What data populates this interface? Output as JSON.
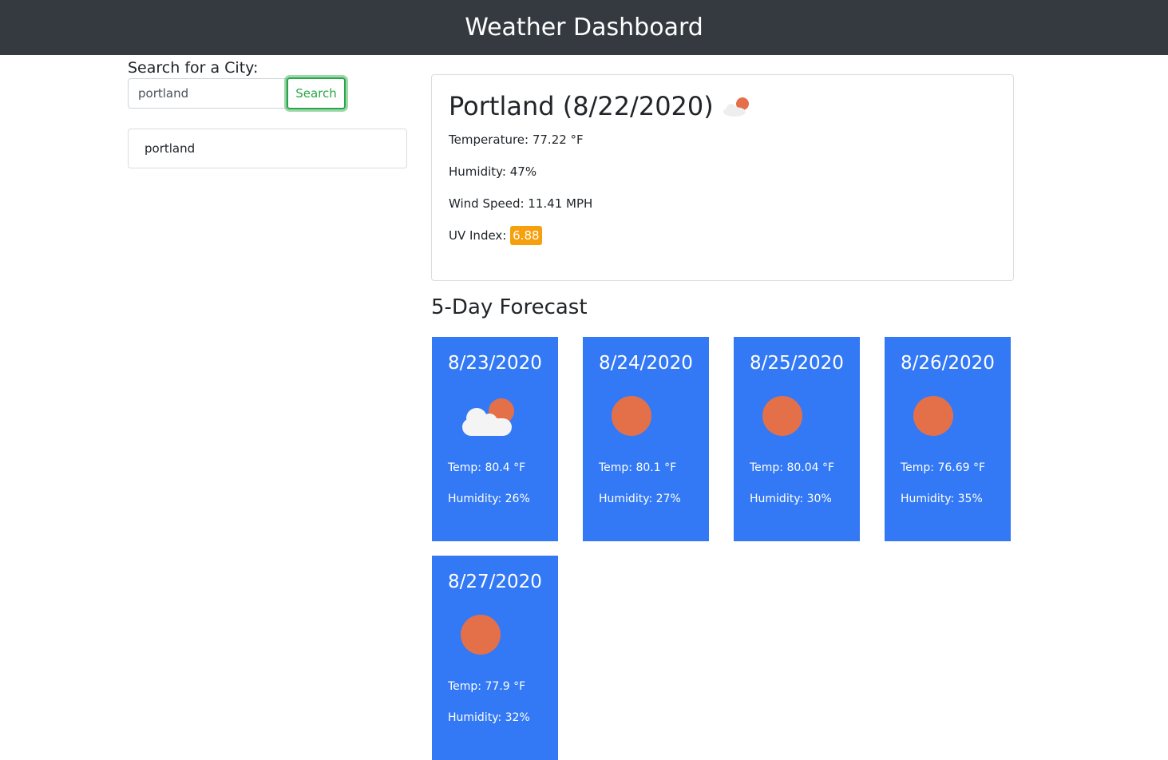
{
  "header": {
    "title": "Weather Dashboard"
  },
  "search": {
    "label": "Search for a City:",
    "value": "portland",
    "button": "Search"
  },
  "history": [
    "portland"
  ],
  "current": {
    "title": "Portland (8/22/2020)",
    "icon": "partly-cloudy-icon",
    "temperature": "Temperature: 77.22 °F",
    "humidity": "Humidity: 47%",
    "wind": "Wind Speed: 11.41 MPH",
    "uv_label": "UV Index:",
    "uv_value": "6.88",
    "uv_color": "#f5a00c"
  },
  "forecast_title": "5-Day Forecast",
  "forecast": [
    {
      "date": "8/23/2020",
      "icon": "partly-cloudy-icon",
      "temp": "Temp: 80.4 °F",
      "humidity": "Humidity: 26%"
    },
    {
      "date": "8/24/2020",
      "icon": "sun-icon",
      "temp": "Temp: 80.1 °F",
      "humidity": "Humidity: 27%"
    },
    {
      "date": "8/25/2020",
      "icon": "sun-icon",
      "temp": "Temp: 80.04 °F",
      "humidity": "Humidity: 30%"
    },
    {
      "date": "8/26/2020",
      "icon": "sun-icon",
      "temp": "Temp: 76.69 °F",
      "humidity": "Humidity: 35%"
    },
    {
      "date": "8/27/2020",
      "icon": "sun-icon",
      "temp": "Temp: 77.9 °F",
      "humidity": "Humidity: 32%"
    }
  ]
}
